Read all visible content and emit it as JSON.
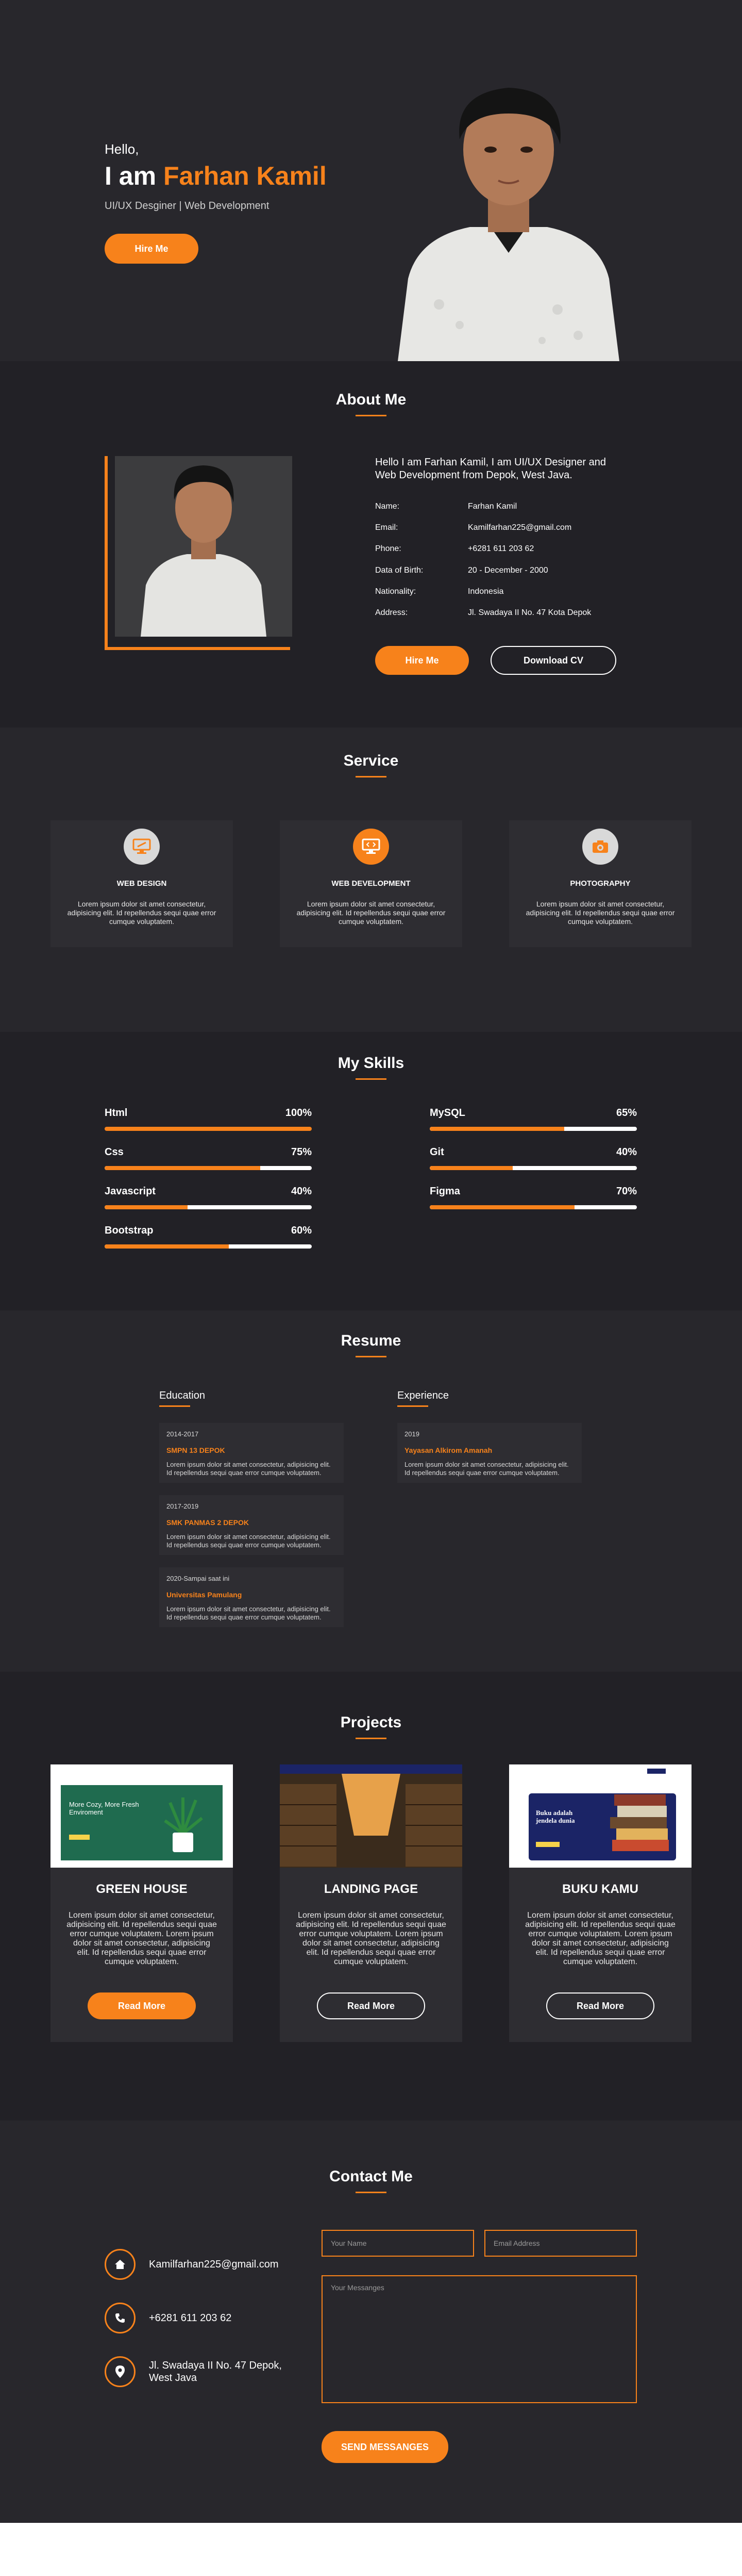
{
  "hero": {
    "greeting": "Hello,",
    "name_prefix": "I am",
    "name": "Farhan Kamil",
    "subtitle": "UI/UX Desginer | Web Development",
    "button": "Hire Me"
  },
  "about": {
    "title": "About Me",
    "intro": "Hello I am Farhan Kamil, I am UI/UX Designer and Web Development from Depok, West Java.",
    "rows": [
      {
        "key": "Name:",
        "value": "Farhan Kamil"
      },
      {
        "key": "Email:",
        "value": "Kamilfarhan225@gmail.com"
      },
      {
        "key": "Phone:",
        "value": "+6281 611 203 62"
      },
      {
        "key": "Data of Birth:",
        "value": "20 - December - 2000"
      },
      {
        "key": "Nationality:",
        "value": "Indonesia"
      },
      {
        "key": "Address:",
        "value": "Jl. Swadaya II No. 47 Kota Depok"
      }
    ],
    "hire_button": "Hire Me",
    "download_button": "Download CV"
  },
  "service": {
    "title": "Service",
    "items": [
      {
        "icon": "monitor-icon",
        "title": "WEB DESIGN",
        "desc": "Lorem ipsum dolor sit amet consectetur, adipisicing elit. Id repellendus sequi quae error cumque voluptatem."
      },
      {
        "icon": "code-monitor-icon",
        "title": "WEB DEVELOPMENT",
        "desc": "Lorem ipsum dolor sit amet consectetur, adipisicing elit. Id repellendus sequi quae error cumque voluptatem."
      },
      {
        "icon": "camera-icon",
        "title": "PHOTOGRAPHY",
        "desc": "Lorem ipsum dolor sit amet consectetur, adipisicing elit. Id repellendus sequi quae error cumque voluptatem."
      }
    ]
  },
  "skills": {
    "title": "My Skills",
    "left": [
      {
        "name": "Html",
        "percent": "100%",
        "level": 100
      },
      {
        "name": "Css",
        "percent": "75%",
        "level": 75
      },
      {
        "name": "Javascript",
        "percent": "40%",
        "level": 40
      },
      {
        "name": "Bootstrap",
        "percent": "60%",
        "level": 60
      }
    ],
    "right": [
      {
        "name": "MySQL",
        "percent": "65%",
        "level": 65
      },
      {
        "name": "Git",
        "percent": "40%",
        "level": 40
      },
      {
        "name": "Figma",
        "percent": "70%",
        "level": 70
      }
    ]
  },
  "resume": {
    "title": "Resume",
    "education_label": "Education",
    "experience_label": "Experience",
    "education": [
      {
        "year": "2014-2017",
        "school": "SMPN 13 DEPOK",
        "desc": "Lorem ipsum dolor sit amet consectetur, adipisicing elit. Id repellendus sequi quae error cumque voluptatem."
      },
      {
        "year": "2017-2019",
        "school": "SMK PANMAS 2 DEPOK",
        "desc": "Lorem ipsum dolor sit amet consectetur, adipisicing elit. Id repellendus sequi quae error cumque voluptatem."
      },
      {
        "year": "2020-Sampai saat ini",
        "school": "Universitas Pamulang",
        "desc": "Lorem ipsum dolor sit amet consectetur, adipisicing elit. Id repellendus sequi quae error cumque voluptatem."
      }
    ],
    "experience": [
      {
        "year": "2019",
        "school": "Yayasan Alkirom Amanah",
        "desc": "Lorem ipsum dolor sit amet consectetur, adipisicing elit. Id repellendus sequi quae error cumque voluptatem."
      }
    ]
  },
  "projects": {
    "title": "Projects",
    "items": [
      {
        "title": "GREEN HOUSE",
        "desc": "Lorem ipsum dolor sit amet consectetur, adipisicing elit. Id repellendus sequi quae error cumque voluptatem. Lorem ipsum dolor sit amet consectetur, adipisicing elit. Id repellendus sequi quae error cumque voluptatem.",
        "button": "Read More",
        "thumb_heading": "More Cozy, More Fresh Enviroment"
      },
      {
        "title": "LANDING PAGE",
        "desc": "Lorem ipsum dolor sit amet consectetur, adipisicing elit. Id repellendus sequi quae error cumque voluptatem. Lorem ipsum dolor sit amet consectetur, adipisicing elit. Id repellendus sequi quae error cumque voluptatem.",
        "button": "Read More",
        "thumb_heading": ""
      },
      {
        "title": "BUKU KAMU",
        "desc": "Lorem ipsum dolor sit amet consectetur, adipisicing elit. Id repellendus sequi quae error cumque voluptatem. Lorem ipsum dolor sit amet consectetur, adipisicing elit. Id repellendus sequi quae error cumque voluptatem.",
        "button": "Read More",
        "thumb_heading": "Buku adalah jendela dunia"
      }
    ]
  },
  "contact": {
    "title": "Contact Me",
    "email": "Kamilfarhan225@gmail.com",
    "phone": "+6281 611 203 62",
    "address": "Jl. Swadaya II No. 47 Depok, West Java",
    "name_placeholder": "Your Name",
    "email_placeholder": "Email Address",
    "message_placeholder": "Your Messanges",
    "send_button": "SEND MESSANGES"
  },
  "colors": {
    "accent": "#f7821b",
    "dark_bg": "#28272c",
    "darker_bg": "#222126",
    "card_bg": "#2e2d32"
  }
}
